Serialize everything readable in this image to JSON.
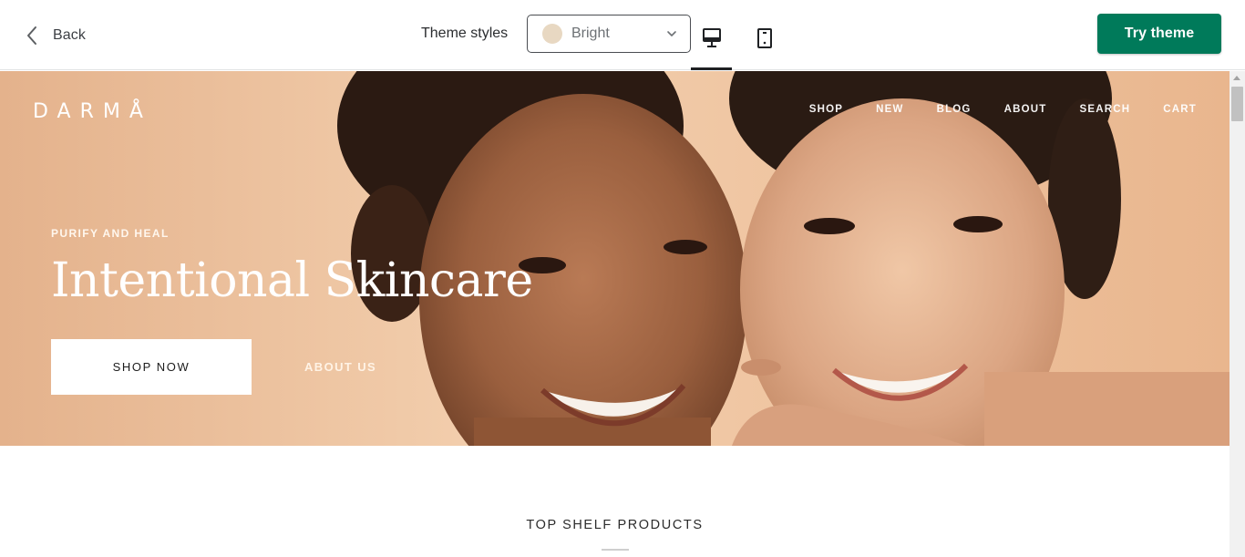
{
  "toolbar": {
    "back_label": "Back",
    "theme_styles_label": "Theme styles",
    "theme_style_value": "Bright",
    "swatch_color": "#e8d8c2",
    "try_theme_label": "Try theme",
    "try_theme_color": "#007a5a",
    "devices": [
      {
        "name": "desktop",
        "icon": "desktop-icon",
        "selected": true
      },
      {
        "name": "mobile",
        "icon": "mobile-icon",
        "selected": false
      }
    ]
  },
  "store": {
    "logo": "DARMÅ",
    "nav": [
      "SHOP",
      "NEW",
      "BLOG",
      "ABOUT",
      "SEARCH",
      "CART"
    ],
    "hero": {
      "eyebrow": "PURIFY AND HEAL",
      "headline": "Intentional Skincare",
      "primary_button": "SHOP NOW",
      "secondary_link": "ABOUT US",
      "image": "two smiling women portrait"
    },
    "section_title": "TOP SHELF PRODUCTS"
  }
}
